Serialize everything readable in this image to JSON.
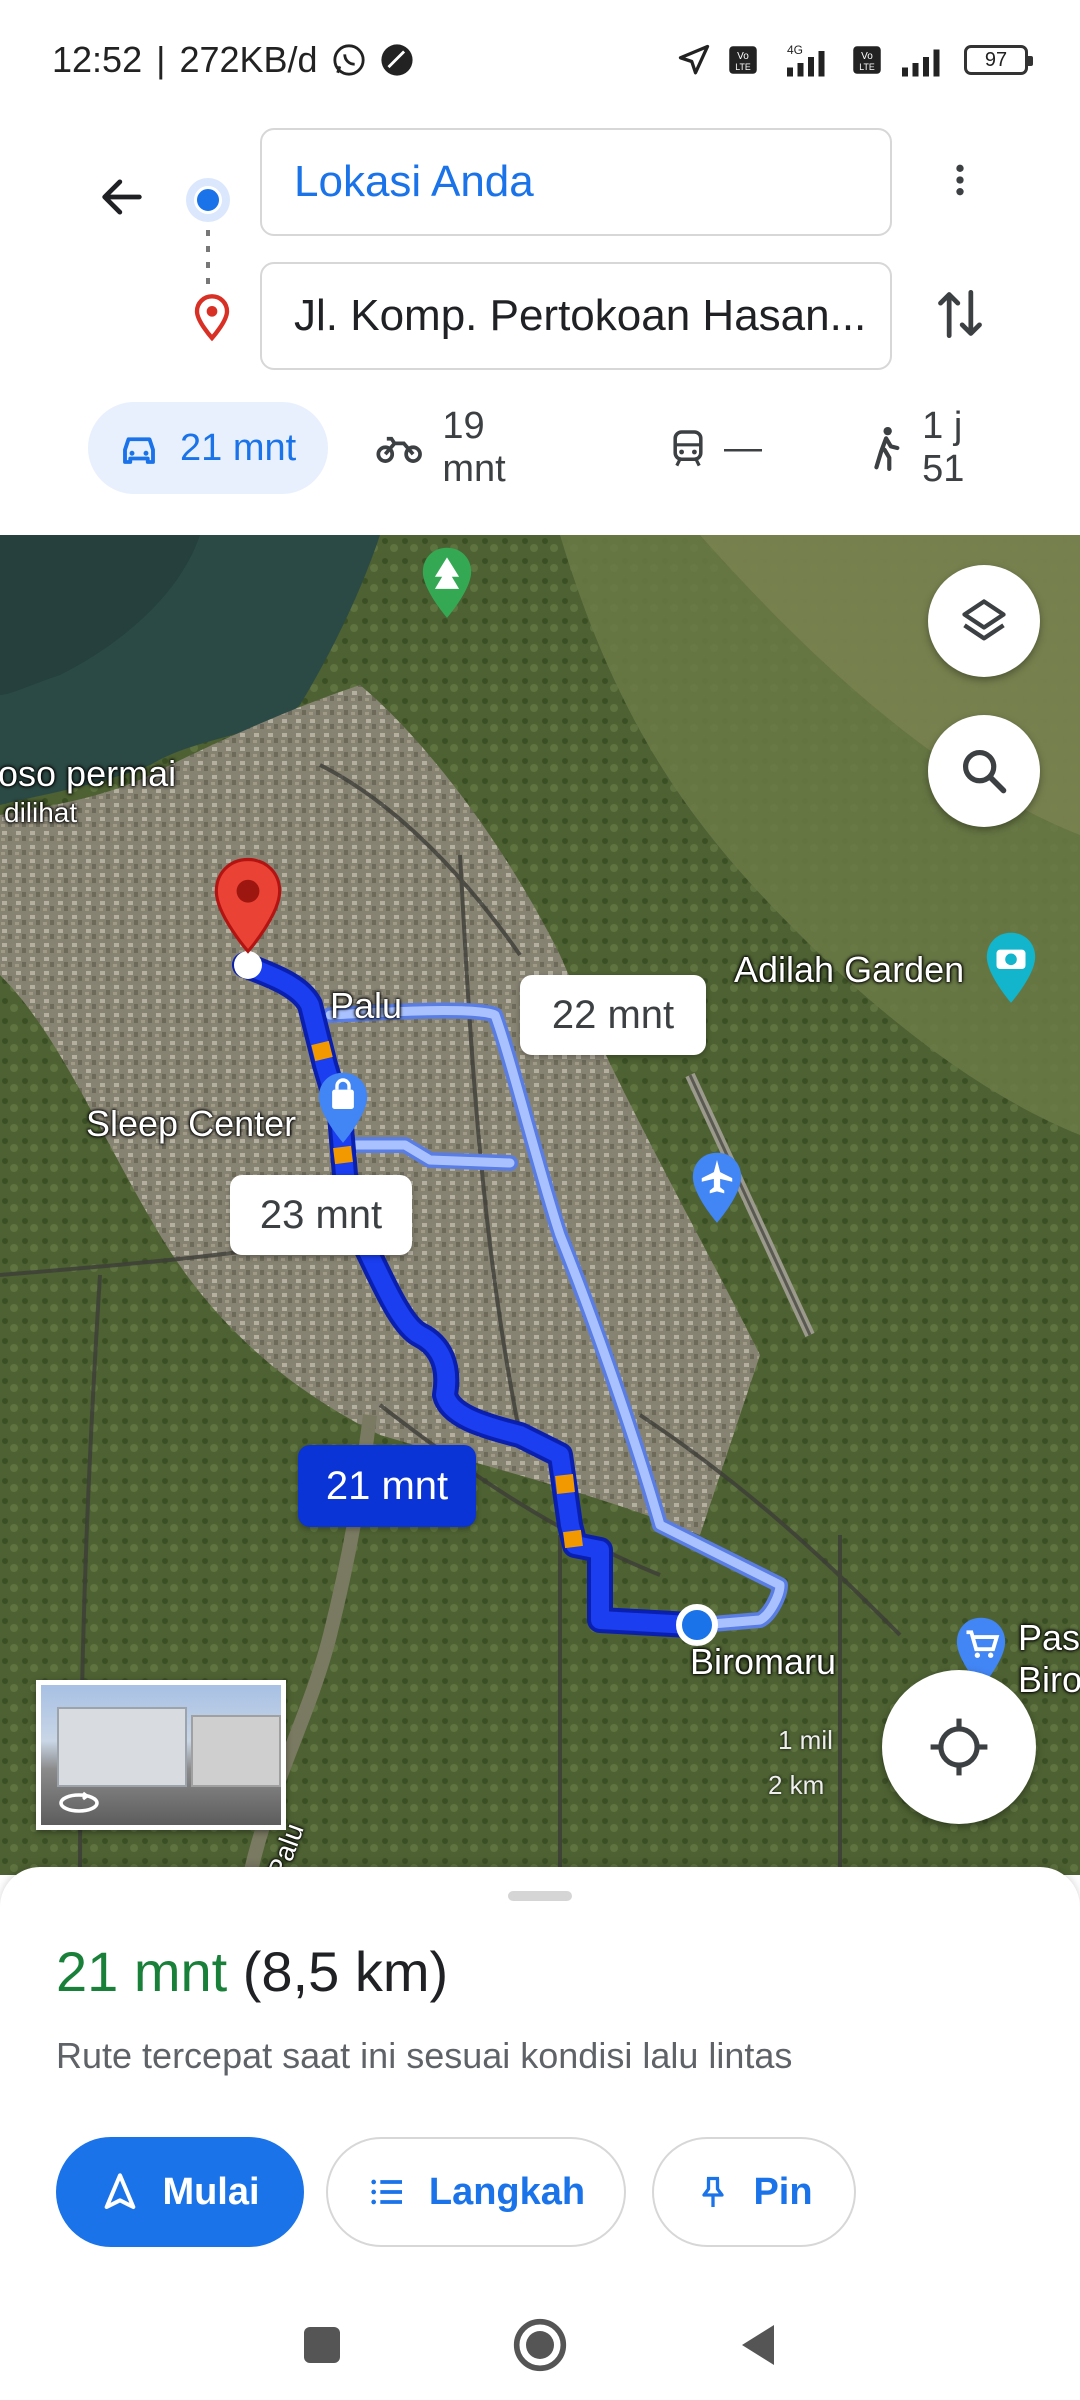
{
  "status_bar": {
    "time": "12:52",
    "data_rate": "272KB/d",
    "network": "4G",
    "battery": "97"
  },
  "route": {
    "origin": "Lokasi Anda",
    "destination": "Jl. Komp. Pertokoan Hasan..."
  },
  "modes": [
    {
      "icon": "car-icon",
      "label": "21 mnt",
      "active": true
    },
    {
      "icon": "motorcycle-icon",
      "label": "19 mnt",
      "active": false
    },
    {
      "icon": "transit-icon",
      "label": "—",
      "active": false
    },
    {
      "icon": "walk-icon",
      "label": "1 j 51",
      "active": false
    }
  ],
  "map": {
    "labels": {
      "poso_permai": "oso permai",
      "dilihat": "dilihat",
      "palu": "Palu",
      "sleep_center": "Sleep Center",
      "adilah_garden": "Adilah Garden",
      "biromaru": "Biromaru",
      "pasar": "Pasa",
      "pasar2": "Biro",
      "palu_river": "Palu"
    },
    "route_bubbles": {
      "main": "21 mnt",
      "alt1": "22 mnt",
      "alt2": "23 mnt"
    },
    "scale": {
      "miles": "1 mil",
      "km": "2 km"
    },
    "colors": {
      "route": "#1a3ef0",
      "alt_route": "#a9c2ff",
      "traffic": "#f29900"
    }
  },
  "sheet": {
    "time": "21 mnt",
    "distance": "(8,5 km)",
    "description": "Rute tercepat saat ini sesuai kondisi lalu lintas",
    "buttons": {
      "start": "Mulai",
      "steps": "Langkah",
      "pin": "Pin"
    }
  }
}
